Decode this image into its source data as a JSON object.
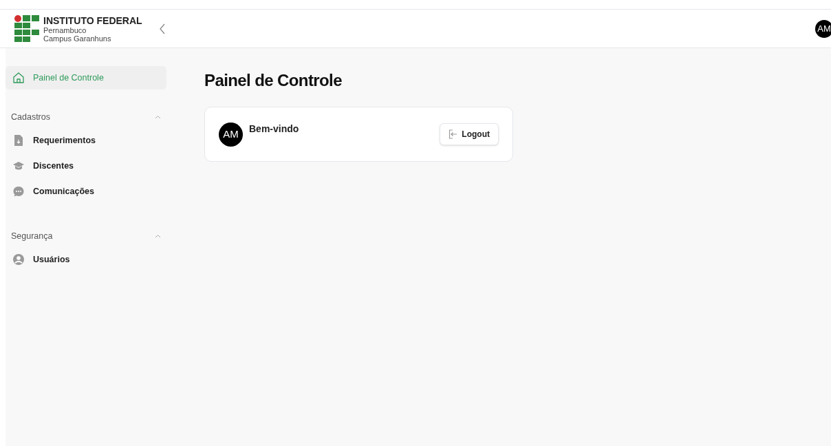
{
  "header": {
    "logo": {
      "title": "INSTITUTO FEDERAL",
      "line_2": "Pernambuco",
      "line_3": "Campus Garanhuns"
    },
    "avatar": "AM"
  },
  "sidebar": {
    "items": [
      {
        "label": "Painel de Controle",
        "kind": "home",
        "selected": true
      }
    ],
    "sections": [
      {
        "title": "Cadastros",
        "expanded": true,
        "items": [
          {
            "label": "Requerimentos",
            "kind": "file",
            "selected": false
          },
          {
            "label": "Discentes",
            "kind": "cap",
            "selected": false
          },
          {
            "label": "Comunicações",
            "kind": "chat",
            "selected": false
          }
        ]
      },
      {
        "title": "Segurança",
        "expanded": true,
        "items": [
          {
            "label": "Usuários",
            "kind": "user",
            "selected": false
          }
        ]
      }
    ]
  },
  "page_title": "Painel de Controle",
  "card": {
    "avatar": "AM",
    "greeting": "Bem-vindo",
    "button": "Logout"
  }
}
